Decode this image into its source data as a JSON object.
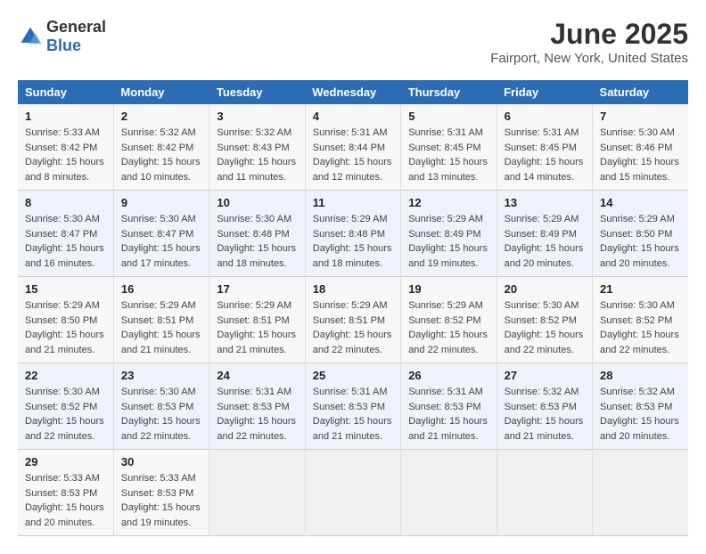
{
  "header": {
    "logo_general": "General",
    "logo_blue": "Blue",
    "title": "June 2025",
    "subtitle": "Fairport, New York, United States"
  },
  "days_of_week": [
    "Sunday",
    "Monday",
    "Tuesday",
    "Wednesday",
    "Thursday",
    "Friday",
    "Saturday"
  ],
  "weeks": [
    {
      "days": [
        {
          "num": "1",
          "sunrise": "Sunrise: 5:33 AM",
          "sunset": "Sunset: 8:42 PM",
          "daylight": "Daylight: 15 hours and 8 minutes."
        },
        {
          "num": "2",
          "sunrise": "Sunrise: 5:32 AM",
          "sunset": "Sunset: 8:42 PM",
          "daylight": "Daylight: 15 hours and 10 minutes."
        },
        {
          "num": "3",
          "sunrise": "Sunrise: 5:32 AM",
          "sunset": "Sunset: 8:43 PM",
          "daylight": "Daylight: 15 hours and 11 minutes."
        },
        {
          "num": "4",
          "sunrise": "Sunrise: 5:31 AM",
          "sunset": "Sunset: 8:44 PM",
          "daylight": "Daylight: 15 hours and 12 minutes."
        },
        {
          "num": "5",
          "sunrise": "Sunrise: 5:31 AM",
          "sunset": "Sunset: 8:45 PM",
          "daylight": "Daylight: 15 hours and 13 minutes."
        },
        {
          "num": "6",
          "sunrise": "Sunrise: 5:31 AM",
          "sunset": "Sunset: 8:45 PM",
          "daylight": "Daylight: 15 hours and 14 minutes."
        },
        {
          "num": "7",
          "sunrise": "Sunrise: 5:30 AM",
          "sunset": "Sunset: 8:46 PM",
          "daylight": "Daylight: 15 hours and 15 minutes."
        }
      ]
    },
    {
      "days": [
        {
          "num": "8",
          "sunrise": "Sunrise: 5:30 AM",
          "sunset": "Sunset: 8:47 PM",
          "daylight": "Daylight: 15 hours and 16 minutes."
        },
        {
          "num": "9",
          "sunrise": "Sunrise: 5:30 AM",
          "sunset": "Sunset: 8:47 PM",
          "daylight": "Daylight: 15 hours and 17 minutes."
        },
        {
          "num": "10",
          "sunrise": "Sunrise: 5:30 AM",
          "sunset": "Sunset: 8:48 PM",
          "daylight": "Daylight: 15 hours and 18 minutes."
        },
        {
          "num": "11",
          "sunrise": "Sunrise: 5:29 AM",
          "sunset": "Sunset: 8:48 PM",
          "daylight": "Daylight: 15 hours and 18 minutes."
        },
        {
          "num": "12",
          "sunrise": "Sunrise: 5:29 AM",
          "sunset": "Sunset: 8:49 PM",
          "daylight": "Daylight: 15 hours and 19 minutes."
        },
        {
          "num": "13",
          "sunrise": "Sunrise: 5:29 AM",
          "sunset": "Sunset: 8:49 PM",
          "daylight": "Daylight: 15 hours and 20 minutes."
        },
        {
          "num": "14",
          "sunrise": "Sunrise: 5:29 AM",
          "sunset": "Sunset: 8:50 PM",
          "daylight": "Daylight: 15 hours and 20 minutes."
        }
      ]
    },
    {
      "days": [
        {
          "num": "15",
          "sunrise": "Sunrise: 5:29 AM",
          "sunset": "Sunset: 8:50 PM",
          "daylight": "Daylight: 15 hours and 21 minutes."
        },
        {
          "num": "16",
          "sunrise": "Sunrise: 5:29 AM",
          "sunset": "Sunset: 8:51 PM",
          "daylight": "Daylight: 15 hours and 21 minutes."
        },
        {
          "num": "17",
          "sunrise": "Sunrise: 5:29 AM",
          "sunset": "Sunset: 8:51 PM",
          "daylight": "Daylight: 15 hours and 21 minutes."
        },
        {
          "num": "18",
          "sunrise": "Sunrise: 5:29 AM",
          "sunset": "Sunset: 8:51 PM",
          "daylight": "Daylight: 15 hours and 22 minutes."
        },
        {
          "num": "19",
          "sunrise": "Sunrise: 5:29 AM",
          "sunset": "Sunset: 8:52 PM",
          "daylight": "Daylight: 15 hours and 22 minutes."
        },
        {
          "num": "20",
          "sunrise": "Sunrise: 5:30 AM",
          "sunset": "Sunset: 8:52 PM",
          "daylight": "Daylight: 15 hours and 22 minutes."
        },
        {
          "num": "21",
          "sunrise": "Sunrise: 5:30 AM",
          "sunset": "Sunset: 8:52 PM",
          "daylight": "Daylight: 15 hours and 22 minutes."
        }
      ]
    },
    {
      "days": [
        {
          "num": "22",
          "sunrise": "Sunrise: 5:30 AM",
          "sunset": "Sunset: 8:52 PM",
          "daylight": "Daylight: 15 hours and 22 minutes."
        },
        {
          "num": "23",
          "sunrise": "Sunrise: 5:30 AM",
          "sunset": "Sunset: 8:53 PM",
          "daylight": "Daylight: 15 hours and 22 minutes."
        },
        {
          "num": "24",
          "sunrise": "Sunrise: 5:31 AM",
          "sunset": "Sunset: 8:53 PM",
          "daylight": "Daylight: 15 hours and 22 minutes."
        },
        {
          "num": "25",
          "sunrise": "Sunrise: 5:31 AM",
          "sunset": "Sunset: 8:53 PM",
          "daylight": "Daylight: 15 hours and 21 minutes."
        },
        {
          "num": "26",
          "sunrise": "Sunrise: 5:31 AM",
          "sunset": "Sunset: 8:53 PM",
          "daylight": "Daylight: 15 hours and 21 minutes."
        },
        {
          "num": "27",
          "sunrise": "Sunrise: 5:32 AM",
          "sunset": "Sunset: 8:53 PM",
          "daylight": "Daylight: 15 hours and 21 minutes."
        },
        {
          "num": "28",
          "sunrise": "Sunrise: 5:32 AM",
          "sunset": "Sunset: 8:53 PM",
          "daylight": "Daylight: 15 hours and 20 minutes."
        }
      ]
    },
    {
      "days": [
        {
          "num": "29",
          "sunrise": "Sunrise: 5:33 AM",
          "sunset": "Sunset: 8:53 PM",
          "daylight": "Daylight: 15 hours and 20 minutes."
        },
        {
          "num": "30",
          "sunrise": "Sunrise: 5:33 AM",
          "sunset": "Sunset: 8:53 PM",
          "daylight": "Daylight: 15 hours and 19 minutes."
        },
        null,
        null,
        null,
        null,
        null
      ]
    }
  ]
}
